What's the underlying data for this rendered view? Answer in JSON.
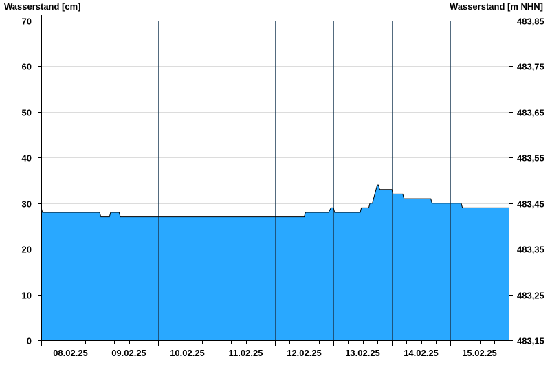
{
  "chart_data": {
    "type": "area",
    "ylabel_left": "Wasserstand [cm]",
    "ylabel_right": "Wasserstand [m NHN]",
    "ylim_left": [
      0,
      70
    ],
    "ylim_right": [
      483.15,
      483.85
    ],
    "yticks_left": [
      "0",
      "10",
      "20",
      "30",
      "40",
      "50",
      "60",
      "70"
    ],
    "yticks_right": [
      "483,15",
      "483,25",
      "483,35",
      "483,45",
      "483,55",
      "483,65",
      "483,75",
      "483,85"
    ],
    "x_start": "2025-02-07T00:00",
    "x_end": "2025-02-15T00:00",
    "x_tick_labels": [
      "08.02.25",
      "09.02.25",
      "10.02.25",
      "11.02.25",
      "12.02.25",
      "13.02.25",
      "14.02.25",
      "15.02.25"
    ],
    "grid": true,
    "fill_color": "#29a8ff",
    "line_color": "#000000",
    "series": [
      {
        "x": [
          "2025-02-07T00:00",
          "2025-02-07T00:30",
          "2025-02-07T01:00",
          "2025-02-08T00:00",
          "2025-02-08T00:30",
          "2025-02-08T04:00",
          "2025-02-08T04:30",
          "2025-02-08T08:00",
          "2025-02-08T08:30",
          "2025-02-08T12:00",
          "2025-02-09T12:00",
          "2025-02-10T12:00",
          "2025-02-11T12:00",
          "2025-02-11T12:30",
          "2025-02-11T13:00",
          "2025-02-11T22:00",
          "2025-02-11T23:00",
          "2025-02-12T00:00",
          "2025-02-12T00:30",
          "2025-02-12T11:00",
          "2025-02-12T11:30",
          "2025-02-12T14:30",
          "2025-02-12T15:00",
          "2025-02-12T16:00",
          "2025-02-12T16:30",
          "2025-02-12T17:00",
          "2025-02-12T17:30",
          "2025-02-12T18:00",
          "2025-02-12T18:30",
          "2025-02-12T19:00",
          "2025-02-12T20:00",
          "2025-02-12T21:00",
          "2025-02-12T21:30",
          "2025-02-13T00:00",
          "2025-02-13T00:30",
          "2025-02-13T01:00",
          "2025-02-13T04:30",
          "2025-02-13T05:00",
          "2025-02-13T16:00",
          "2025-02-13T16:30",
          "2025-02-14T04:30",
          "2025-02-14T05:00",
          "2025-02-15T00:00"
        ],
        "y": [
          29,
          28,
          28,
          28,
          27,
          27,
          28,
          28,
          27,
          27,
          27,
          27,
          27,
          28,
          28,
          28,
          29,
          29,
          28,
          28,
          29,
          29,
          30,
          30,
          31,
          32,
          33,
          34,
          34,
          33,
          33,
          33,
          33,
          33,
          32,
          32,
          32,
          31,
          31,
          30,
          30,
          29,
          29
        ]
      }
    ]
  }
}
